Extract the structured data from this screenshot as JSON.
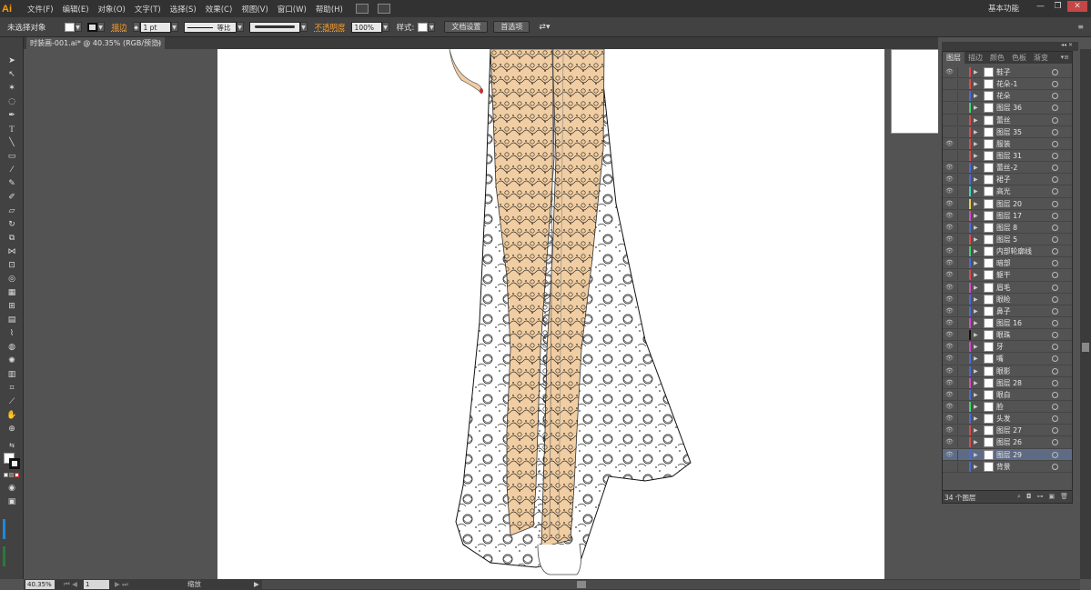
{
  "app": {
    "logo": "Ai"
  },
  "menu": [
    "文件(F)",
    "编辑(E)",
    "对象(O)",
    "文字(T)",
    "选择(S)",
    "效果(C)",
    "视图(V)",
    "窗口(W)",
    "帮助(H)"
  ],
  "workspace": "基本功能",
  "window_buttons": {
    "minimize": "—",
    "restore": "❐",
    "close": "✕"
  },
  "control": {
    "selection": "未选择对象",
    "stroke_label": "描边",
    "stroke_weight": "1 pt",
    "stroke_profile": "等比",
    "opacity_label": "不透明度",
    "opacity": "100%",
    "style_label": "样式:",
    "doc_setup": "文档设置",
    "preferences": "首选项"
  },
  "document_tab": {
    "title": "时装画-001.ai* @ 40.35% (RGB/预览)",
    "close": "×"
  },
  "status": {
    "zoom": "40.35%",
    "page": "1",
    "label": "缩放"
  },
  "layers_panel": {
    "tabs": [
      "图层",
      "描边",
      "颜色",
      "色板",
      "渐变"
    ],
    "count": "34 个图层",
    "layers": [
      {
        "name": "鞋子",
        "color": "#e04848",
        "visible": true
      },
      {
        "name": "花朵-1",
        "color": "#e04848",
        "visible": false
      },
      {
        "name": "花朵",
        "color": "#4a6ad8",
        "visible": false
      },
      {
        "name": "图层 36",
        "color": "#3ad66a",
        "visible": false
      },
      {
        "name": "蕾丝",
        "color": "#e04848",
        "visible": false
      },
      {
        "name": "图层 35",
        "color": "#e04848",
        "visible": false
      },
      {
        "name": "服装",
        "color": "#e04848",
        "visible": true
      },
      {
        "name": "图层 31",
        "color": "#e04848",
        "visible": false
      },
      {
        "name": "蕾丝-2",
        "color": "#4a6ad8",
        "visible": true
      },
      {
        "name": "裙子",
        "color": "#4a6ad8",
        "visible": true
      },
      {
        "name": "高光",
        "color": "#3ad6c8",
        "visible": true
      },
      {
        "name": "图层 20",
        "color": "#e8d040",
        "visible": true
      },
      {
        "name": "图层 17",
        "color": "#d848c8",
        "visible": true
      },
      {
        "name": "图层 8",
        "color": "#4a6ad8",
        "visible": true
      },
      {
        "name": "图层 5",
        "color": "#e04848",
        "visible": true
      },
      {
        "name": "内部轮廓线",
        "color": "#3ad66a",
        "visible": true
      },
      {
        "name": "暗部",
        "color": "#4a6ad8",
        "visible": true
      },
      {
        "name": "躯干",
        "color": "#e04848",
        "visible": true
      },
      {
        "name": "眉毛",
        "color": "#d848c8",
        "visible": true
      },
      {
        "name": "眼睑",
        "color": "#4a6ad8",
        "visible": true
      },
      {
        "name": "鼻子",
        "color": "#4a6ad8",
        "visible": true
      },
      {
        "name": "图层 16",
        "color": "#d848c8",
        "visible": true
      },
      {
        "name": "眼珠",
        "color": "#111111",
        "visible": true
      },
      {
        "name": "牙",
        "color": "#d848c8",
        "visible": true
      },
      {
        "name": "嘴",
        "color": "#4a6ad8",
        "visible": true
      },
      {
        "name": "眼影",
        "color": "#4a6ad8",
        "visible": true
      },
      {
        "name": "图层 28",
        "color": "#d848c8",
        "visible": true
      },
      {
        "name": "眼白",
        "color": "#4a6ad8",
        "visible": true
      },
      {
        "name": "脸",
        "color": "#3ad66a",
        "visible": true
      },
      {
        "name": "头发",
        "color": "#4a6ad8",
        "visible": true
      },
      {
        "name": "图层 27",
        "color": "#e04848",
        "visible": true
      },
      {
        "name": "图层 26",
        "color": "#e04848",
        "visible": true
      },
      {
        "name": "图层 29",
        "color": "#4a6ad8",
        "visible": true,
        "selected": true
      },
      {
        "name": "背景",
        "color": "#4a6ad8",
        "visible": false
      }
    ]
  }
}
